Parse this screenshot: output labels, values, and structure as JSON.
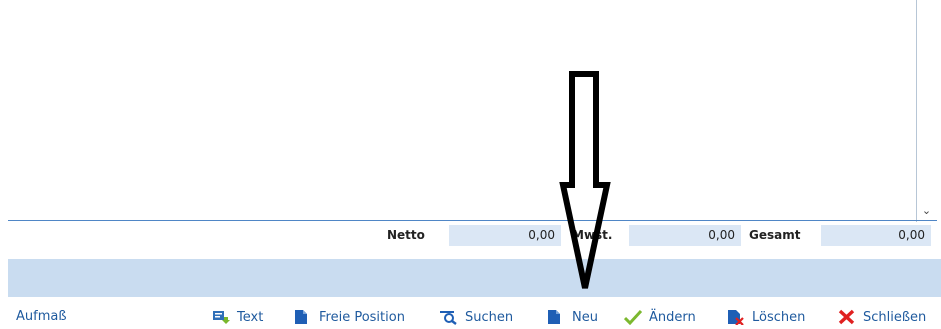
{
  "totals": {
    "netto_label": "Netto",
    "netto_value": "0,00",
    "mwst_label": "Mwst.",
    "mwst_value": "0,00",
    "gesamt_label": "Gesamt",
    "gesamt_value": "0,00"
  },
  "toolbar": {
    "aufmass_label": "Aufmaß",
    "text_label": "Text",
    "freie_position_label": "Freie Position",
    "suchen_label": "Suchen",
    "neu_label": "Neu",
    "aendern_label": "Ändern",
    "loeschen_label": "Löschen",
    "schliessen_label": "Schließen"
  },
  "colors": {
    "accent": "#1f5a9e",
    "band": "#c9dcf0",
    "field": "#dbe7f5",
    "check": "#7cb82f",
    "close": "#e02020"
  },
  "icons": [
    "text-icon",
    "document-icon",
    "search-icon",
    "document-icon",
    "check-icon",
    "delete-document-icon",
    "close-icon",
    "chevron-down-icon",
    "arrow-annotation"
  ]
}
